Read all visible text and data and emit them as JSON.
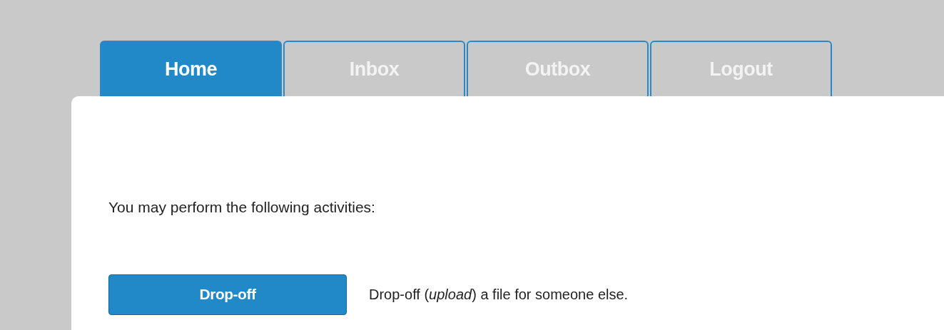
{
  "tabs": [
    {
      "label": "Home",
      "selected": true
    },
    {
      "label": "Inbox",
      "selected": false
    },
    {
      "label": "Outbox",
      "selected": false
    },
    {
      "label": "Logout",
      "selected": false
    }
  ],
  "intro": "You may perform the following activities:",
  "activities": [
    {
      "button": "Drop-off",
      "description": "Drop-off (*upload*) a file for someone else."
    }
  ]
}
